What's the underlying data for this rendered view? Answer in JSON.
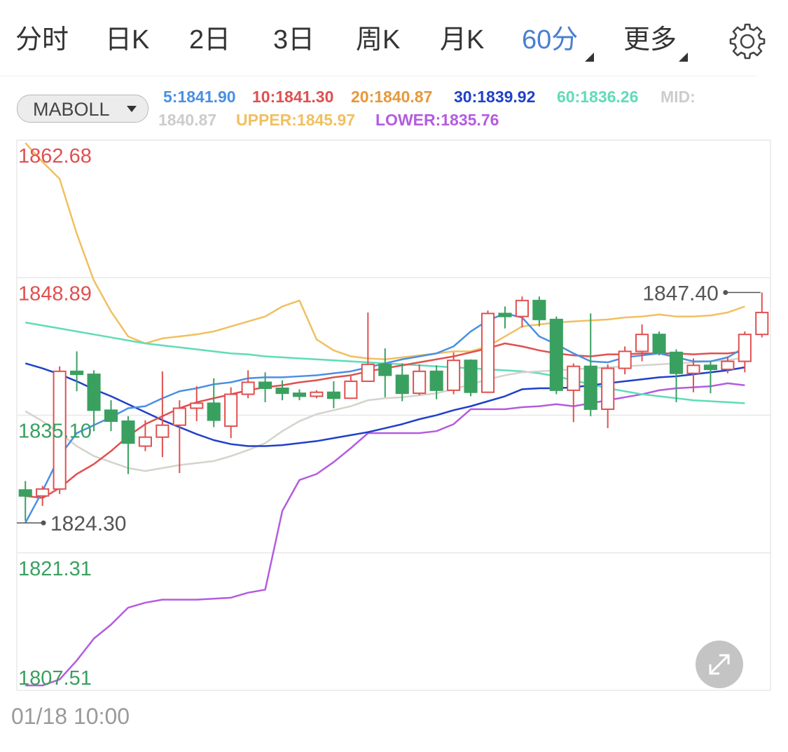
{
  "tabs": [
    {
      "label": "分时",
      "active": false
    },
    {
      "label": "日K",
      "active": false
    },
    {
      "label": "2日",
      "active": false
    },
    {
      "label": "3日",
      "active": false
    },
    {
      "label": "周K",
      "active": false
    },
    {
      "label": "月K",
      "active": false
    },
    {
      "label": "60分",
      "active": true
    },
    {
      "label": "更多",
      "active": false
    }
  ],
  "icons": {
    "settings": "gear-icon",
    "expand": "expand-arrows-icon",
    "select": "caret-down-icon"
  },
  "indicator_select": {
    "label": "MABOLL"
  },
  "legend": {
    "ma5": {
      "label": "5:1841.90",
      "color": "#4a90e2"
    },
    "ma10": {
      "label": "10:1841.30",
      "color": "#e05050"
    },
    "ma20": {
      "label": "20:1840.87",
      "color": "#e8983a"
    },
    "ma30": {
      "label": "30:1839.92",
      "color": "#2040c8"
    },
    "ma60": {
      "label": "60:1836.26",
      "color": "#5fdcb8"
    },
    "mid_label": {
      "label": "MID:",
      "color": "#cccccc"
    },
    "mid_value": {
      "label": "1840.87",
      "color": "#cccccc"
    },
    "upper": {
      "label": "UPPER:1845.97",
      "color": "#f0c060"
    },
    "lower": {
      "label": "LOWER:1835.76",
      "color": "#b35ce0"
    }
  },
  "colors": {
    "up": "#e05050",
    "down": "#3aa060",
    "axis_up": "#e05050",
    "axis_down": "#3aa060",
    "grid": "#e8e8e8"
  },
  "date_label": "01/18 10:00",
  "chart_data": {
    "type": "candlestick",
    "y_range": [
      1807.51,
      1862.68
    ],
    "y_ticks": [
      "1862.68",
      "1848.89",
      "1835.10",
      "1821.31",
      "1807.51"
    ],
    "max_annotation": "1847.40",
    "min_annotation": "1824.30",
    "candles": [
      [
        1827.6,
        1827.0,
        1828.5,
        1824.5
      ],
      [
        1827.0,
        1827.7,
        1828.0,
        1826.0
      ],
      [
        1827.7,
        1839.5,
        1840.0,
        1827.2
      ],
      [
        1839.5,
        1839.2,
        1841.5,
        1837.5
      ],
      [
        1839.2,
        1835.6,
        1839.6,
        1833.5
      ],
      [
        1835.6,
        1834.5,
        1836.6,
        1833.5
      ],
      [
        1834.5,
        1832.3,
        1835.0,
        1829.2
      ],
      [
        1832.0,
        1832.9,
        1834.6,
        1831.5
      ],
      [
        1832.9,
        1834.1,
        1839.5,
        1830.9
      ],
      [
        1834.1,
        1835.8,
        1836.6,
        1829.3
      ],
      [
        1835.8,
        1836.3,
        1838.0,
        1834.5
      ],
      [
        1836.3,
        1834.6,
        1838.8,
        1833.9
      ],
      [
        1834.0,
        1837.2,
        1837.9,
        1832.8
      ],
      [
        1837.2,
        1838.4,
        1839.6,
        1836.8
      ],
      [
        1838.4,
        1837.8,
        1839.4,
        1836.4
      ],
      [
        1837.8,
        1837.3,
        1838.6,
        1836.6
      ],
      [
        1837.3,
        1837.0,
        1837.7,
        1836.6
      ],
      [
        1837.0,
        1837.4,
        1837.6,
        1836.8
      ],
      [
        1837.4,
        1836.8,
        1838.5,
        1835.8
      ],
      [
        1836.8,
        1838.5,
        1839.0,
        1836.8
      ],
      [
        1838.5,
        1840.2,
        1845.4,
        1839.0
      ],
      [
        1840.2,
        1839.1,
        1841.8,
        1836.9
      ],
      [
        1839.1,
        1837.3,
        1840.3,
        1836.5
      ],
      [
        1837.3,
        1839.5,
        1840.2,
        1837.1
      ],
      [
        1839.5,
        1837.6,
        1840.1,
        1836.7
      ],
      [
        1837.6,
        1840.6,
        1841.4,
        1837.2
      ],
      [
        1840.6,
        1837.4,
        1840.7,
        1837.0
      ],
      [
        1837.4,
        1845.3,
        1845.6,
        1837.4
      ],
      [
        1845.3,
        1845.0,
        1846.0,
        1843.8
      ],
      [
        1845.0,
        1846.6,
        1847.0,
        1843.9
      ],
      [
        1846.6,
        1844.7,
        1847.0,
        1844.0
      ],
      [
        1844.7,
        1837.6,
        1845.0,
        1837.2
      ],
      [
        1837.6,
        1840.0,
        1840.3,
        1834.4
      ],
      [
        1840.0,
        1835.7,
        1845.3,
        1835.0
      ],
      [
        1835.7,
        1839.8,
        1840.2,
        1833.8
      ],
      [
        1839.8,
        1841.5,
        1842.0,
        1839.2
      ],
      [
        1841.5,
        1843.2,
        1844.2,
        1840.5
      ],
      [
        1843.2,
        1841.4,
        1843.5,
        1841.1
      ],
      [
        1841.4,
        1839.3,
        1841.7,
        1836.4
      ],
      [
        1839.3,
        1840.1,
        1840.8,
        1837.4
      ],
      [
        1840.1,
        1839.7,
        1840.5,
        1837.3
      ],
      [
        1839.7,
        1840.5,
        1841.0,
        1839.3
      ],
      [
        1840.5,
        1843.2,
        1843.5,
        1839.4
      ],
      [
        1843.2,
        1845.4,
        1847.4,
        1842.9
      ]
    ],
    "ma5": [
      1824.3,
      1827.5,
      1831.0,
      1833.3,
      1834.1,
      1834.9,
      1835.8,
      1836.0,
      1836.8,
      1837.5,
      1837.8,
      1838.2,
      1838.4,
      1838.8,
      1838.9,
      1838.9,
      1839.0,
      1839.1,
      1839.3,
      1839.5,
      1839.9,
      1840.3,
      1840.7,
      1841.0,
      1841.3,
      1842.0,
      1843.5,
      1844.6,
      1845.3,
      1844.9,
      1843.0,
      1842.2,
      1841.3,
      1840.5,
      1840.4,
      1840.9,
      1841.1,
      1841.3,
      1840.9,
      1840.5,
      1840.5,
      1840.9,
      1841.9
    ],
    "ma10": [
      1827.0,
      1826.8,
      1827.8,
      1829.2,
      1830.2,
      1831.5,
      1833.0,
      1834.2,
      1835.0,
      1835.8,
      1836.4,
      1836.8,
      1837.2,
      1837.6,
      1837.9,
      1838.1,
      1838.4,
      1838.6,
      1838.9,
      1839.1,
      1839.5,
      1839.8,
      1840.1,
      1840.4,
      1840.7,
      1841.0,
      1841.4,
      1841.8,
      1842.3,
      1842.0,
      1841.6,
      1841.3,
      1841.1,
      1841.0,
      1841.2,
      1841.2,
      1841.3,
      1841.3,
      1841.3,
      1841.2,
      1841.3,
      1841.3,
      1841.5
    ],
    "ma30": [
      1840.3,
      1839.8,
      1839.2,
      1838.5,
      1837.7,
      1837.0,
      1836.2,
      1835.4,
      1834.6,
      1833.9,
      1833.2,
      1832.6,
      1832.2,
      1832.0,
      1832.0,
      1832.1,
      1832.3,
      1832.5,
      1832.8,
      1833.1,
      1833.4,
      1833.8,
      1834.2,
      1834.7,
      1835.1,
      1835.6,
      1836.0,
      1836.5,
      1837.0,
      1837.7,
      1837.8,
      1837.8,
      1837.9,
      1838.1,
      1838.3,
      1838.5,
      1838.7,
      1838.9,
      1839.0,
      1839.2,
      1839.4,
      1839.6,
      1839.9
    ],
    "ma60": [
      1844.4,
      1844.1,
      1843.8,
      1843.5,
      1843.2,
      1842.9,
      1842.6,
      1842.3,
      1842.1,
      1841.9,
      1841.7,
      1841.5,
      1841.3,
      1841.2,
      1841.0,
      1840.9,
      1840.8,
      1840.7,
      1840.6,
      1840.5,
      1840.4,
      1840.3,
      1840.2,
      1840.1,
      1840.0,
      1839.9,
      1839.8,
      1839.7,
      1839.6,
      1839.5,
      1839.3,
      1839.0,
      1838.6,
      1838.2,
      1837.8,
      1837.5,
      1837.2,
      1837.0,
      1836.8,
      1836.6,
      1836.5,
      1836.4,
      1836.3
    ],
    "mid": [
      1835.5,
      1834.5,
      1833.3,
      1832.0,
      1831.0,
      1830.4,
      1829.8,
      1829.5,
      1829.8,
      1830.1,
      1830.3,
      1830.5,
      1831.0,
      1831.6,
      1832.3,
      1833.5,
      1834.5,
      1835.2,
      1835.6,
      1836.0,
      1836.6,
      1836.8,
      1836.9,
      1837.1,
      1837.3,
      1837.7,
      1838.2,
      1838.7,
      1839.1,
      1839.4,
      1839.5,
      1839.6,
      1839.7,
      1839.8,
      1839.9,
      1840.0,
      1840.1,
      1840.2,
      1840.3,
      1840.4,
      1840.5,
      1840.6,
      1840.9
    ],
    "upper": [
      1862.4,
      1860.5,
      1858.8,
      1853.3,
      1848.6,
      1845.5,
      1843.0,
      1842.3,
      1842.8,
      1843.0,
      1843.2,
      1843.5,
      1844.0,
      1844.5,
      1845.0,
      1846.0,
      1846.6,
      1842.7,
      1841.6,
      1841.0,
      1840.8,
      1840.7,
      1840.9,
      1841.1,
      1841.3,
      1841.5,
      1841.5,
      1842.0,
      1843.0,
      1844.0,
      1844.2,
      1844.4,
      1844.5,
      1844.6,
      1844.7,
      1844.9,
      1845.0,
      1845.2,
      1845.0,
      1845.0,
      1845.1,
      1845.4,
      1846.0
    ],
    "lower": [
      1808.0,
      1808.0,
      1808.6,
      1810.5,
      1812.7,
      1814.1,
      1815.8,
      1816.3,
      1816.6,
      1816.6,
      1816.6,
      1816.7,
      1816.8,
      1817.3,
      1817.6,
      1825.5,
      1828.6,
      1829.2,
      1830.4,
      1831.8,
      1833.3,
      1833.3,
      1833.3,
      1833.3,
      1833.5,
      1834.2,
      1835.7,
      1835.7,
      1835.7,
      1835.9,
      1836.0,
      1836.2,
      1836.0,
      1836.3,
      1836.6,
      1836.9,
      1837.2,
      1837.6,
      1837.8,
      1837.9,
      1838.0,
      1838.3,
      1838.1
    ]
  }
}
